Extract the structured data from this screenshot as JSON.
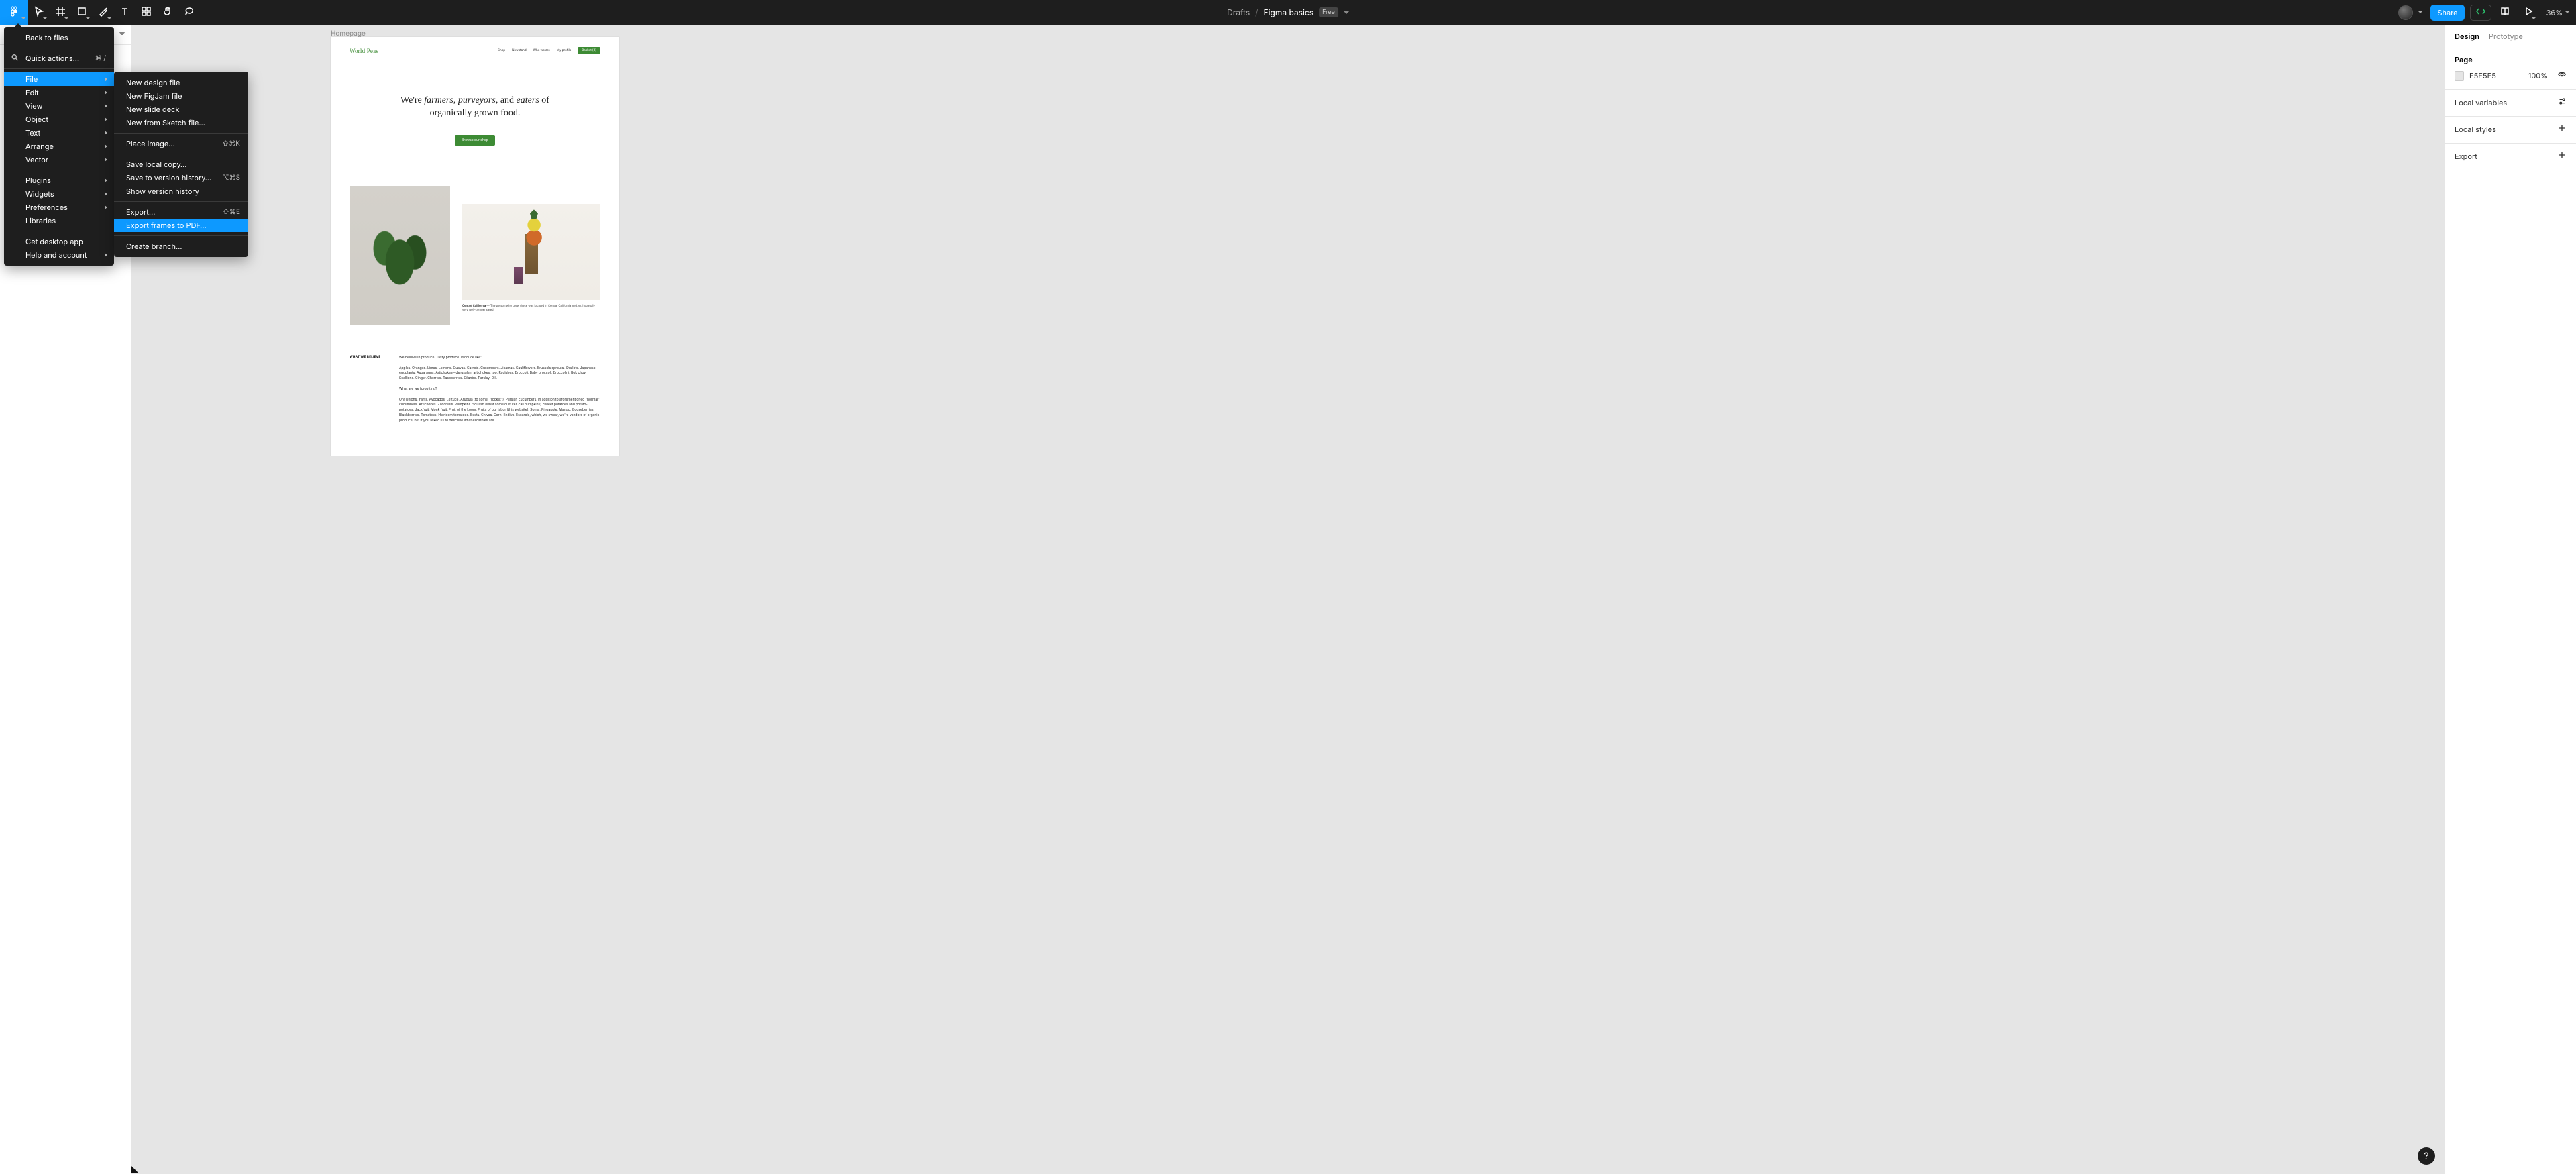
{
  "toolbar": {
    "drafts": "Drafts",
    "separator": "/",
    "title": "Figma basics",
    "badge": "Free",
    "share": "Share",
    "zoom": "36%"
  },
  "menu": {
    "back": "Back to files",
    "quick": {
      "label": "Quick actions…",
      "shortcut": "⌘ /"
    },
    "file": "File",
    "edit": "Edit",
    "view": "View",
    "object": "Object",
    "text": "Text",
    "arrange": "Arrange",
    "vector": "Vector",
    "plugins": "Plugins",
    "widgets": "Widgets",
    "preferences": "Preferences",
    "libraries": "Libraries",
    "get_app": "Get desktop app",
    "help": "Help and account"
  },
  "submenu": {
    "new_design": "New design file",
    "new_figjam": "New FigJam file",
    "new_slide": "New slide deck",
    "new_sketch": "New from Sketch file…",
    "place_image": {
      "label": "Place image…",
      "shortcut": "⇧⌘K"
    },
    "save_local": "Save local copy…",
    "save_history": {
      "label": "Save to version history…",
      "shortcut": "⌥⌘S"
    },
    "show_history": "Show version history",
    "export": {
      "label": "Export…",
      "shortcut": "⇧⌘E"
    },
    "export_pdf": "Export frames to PDF…",
    "create_branch": "Create branch…"
  },
  "right": {
    "tabs": {
      "design": "Design",
      "prototype": "Prototype"
    },
    "page": {
      "title": "Page",
      "hex": "E5E5E5",
      "opacity": "100%"
    },
    "local_vars": "Local variables",
    "local_styles": "Local styles",
    "export": "Export"
  },
  "canvas": {
    "frame_label": "Homepage"
  },
  "artboard": {
    "logo": "World Peas",
    "nav": {
      "shop": "Shop",
      "newstand": "Newstand",
      "who": "Who we are",
      "profile": "My profile",
      "basket": "Basket (3)"
    },
    "hero": {
      "l1a": "We're ",
      "l1b": "farmers",
      "l1c": ", ",
      "l1d": "purveyors",
      "l1e": ", and ",
      "l1f": "eaters",
      "l1g": " of",
      "l2": "organically grown food.",
      "cta": "Browse our shop"
    },
    "caption": {
      "bold": "Central California",
      "rest": " — The person who grew these was located in Central California and, er, hopefully very well-compensated."
    },
    "believe": {
      "label": "WHAT WE BELIEVE",
      "p1": "We believe in produce. Tasty produce. Produce like:",
      "p2": "Apples. Oranges. Limes. Lemons. Guavas. Carrots. Cucumbers. Jicamas. Cauliflowers. Brussels sprouts. Shallots. Japanese eggplants. Asparagus. Artichokes—Jerusalem artichokes, too. Radishes. Broccoli. Baby broccoli. Broccolini. Bok choy. Scallions. Ginger. Cherries. Raspberries. Cilantro. Parsley. Dill.",
      "p3": "What are we forgetting?",
      "p4": "Oh! Onions. Yams. Avocados. Lettuce. Arugula (to some, \"rocket\"). Persian cucumbers, in addition to aforementioned \"normal\" cucumbers. Artichokes. Zucchinis. Pumpkins. Squash (what some cultures call pumpkins). Sweet potatoes and potato-potatoes. Jackfruit. Monk fruit. Fruit of the Loom. Fruits of our labor (this website). Sorrel. Pineapple. Mango. Gooseberries. Blackberries. Tomatoes. Heirloom tomatoes. Beets. Chives. Corn. Endive. Escarole, which, we swear, we're vendors of organic produce, but if you asked us to describe what escaroles are…"
    }
  },
  "help": "?"
}
